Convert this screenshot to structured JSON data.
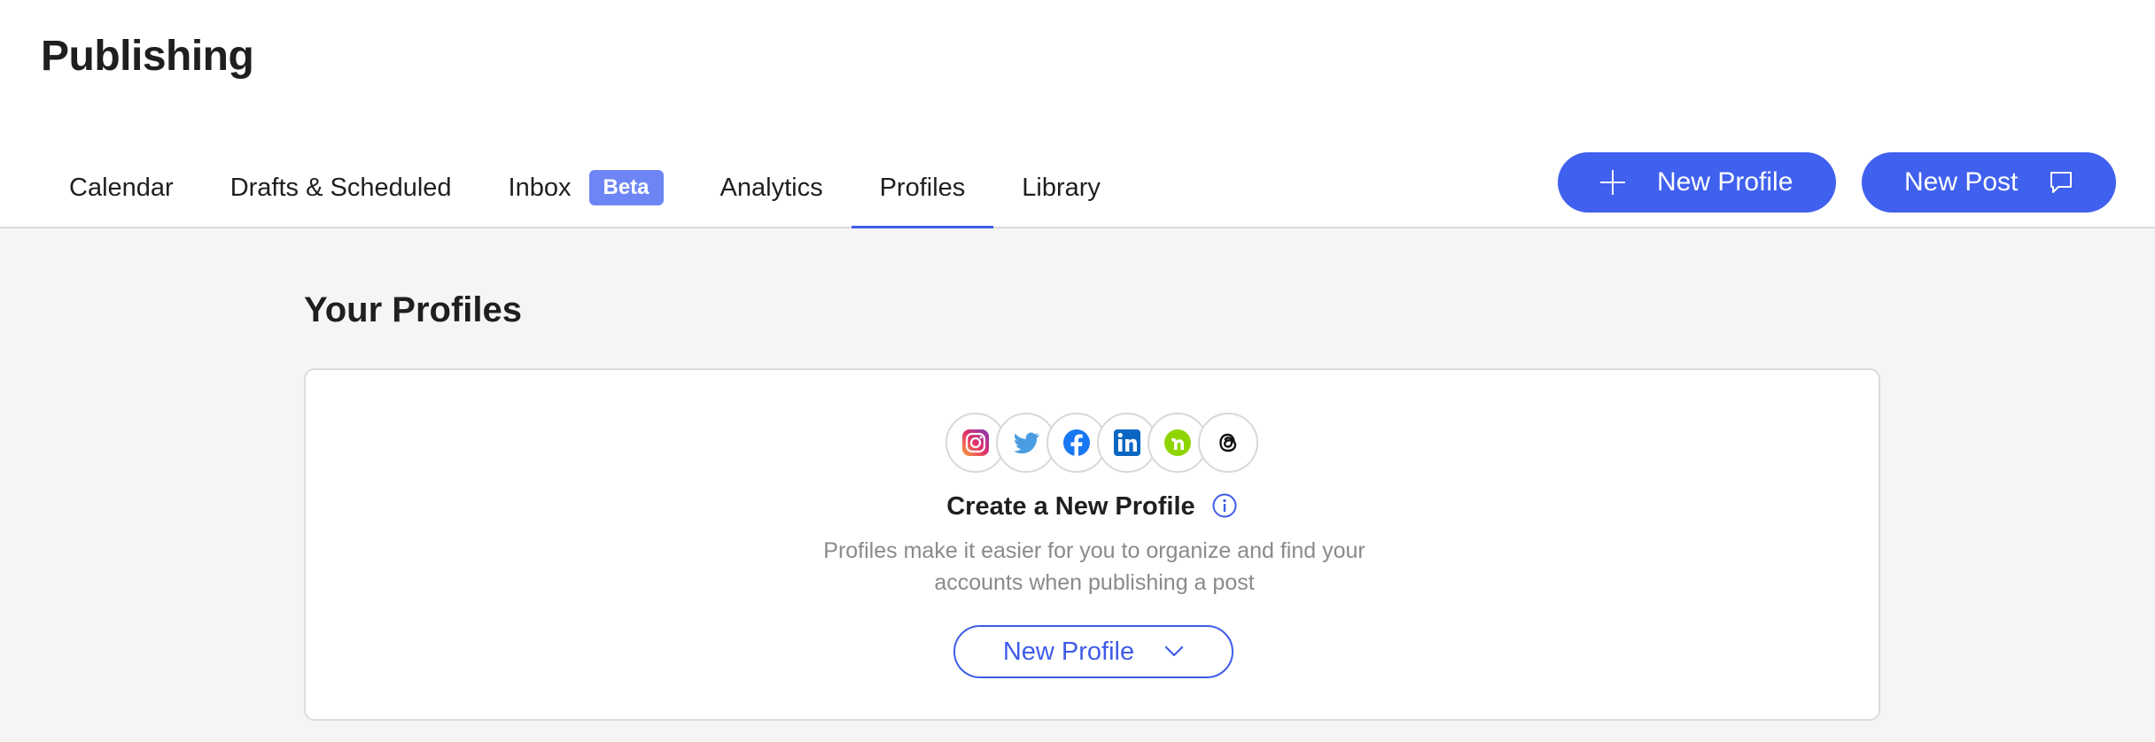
{
  "header": {
    "title": "Publishing",
    "tabs": [
      {
        "label": "Calendar"
      },
      {
        "label": "Drafts & Scheduled"
      },
      {
        "label": "Inbox",
        "badge": "Beta"
      },
      {
        "label": "Analytics"
      },
      {
        "label": "Profiles",
        "active": true
      },
      {
        "label": "Library"
      }
    ],
    "new_profile_label": "New Profile",
    "new_post_label": "New Post"
  },
  "main": {
    "section_title": "Your Profiles",
    "card": {
      "networks": [
        "instagram-icon",
        "twitter-icon",
        "facebook-icon",
        "linkedin-icon",
        "nextdoor-icon",
        "threads-icon"
      ],
      "title": "Create a New Profile",
      "description_line1": "Profiles make it easier for you to organize and find your",
      "description_line2": "accounts when publishing a post",
      "button_label": "New Profile"
    }
  },
  "colors": {
    "accent": "#4060ee",
    "badge": "#6e86f5",
    "content_bg": "#f5f5f5"
  }
}
